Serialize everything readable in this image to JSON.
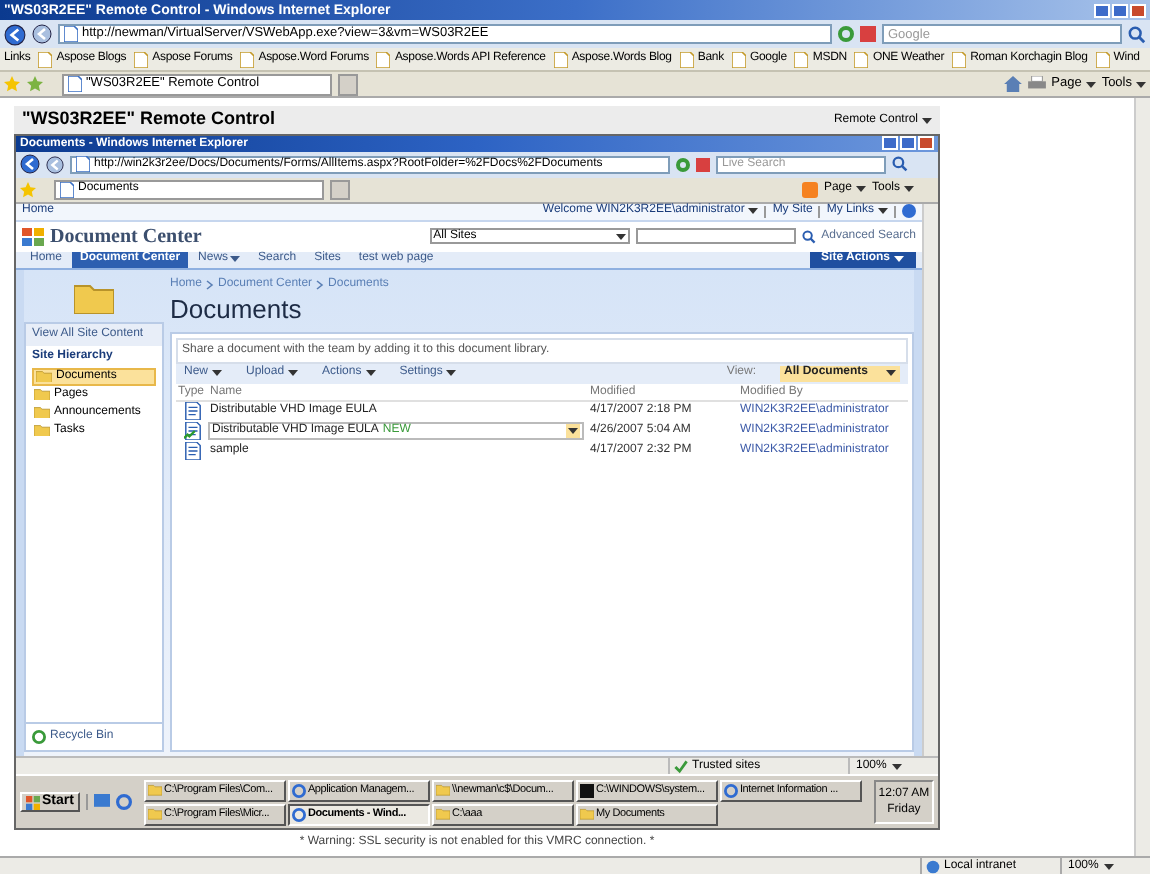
{
  "window": {
    "title": "\"WS03R2EE\" Remote Control - Windows Internet Explorer",
    "address": "http://newman/VirtualServer/VSWebApp.exe?view=3&vm=WS03R2EE",
    "search_placeholder": "Google",
    "links_label": "Links",
    "links": [
      "Aspose Blogs",
      "Aspose Forums",
      "Aspose.Word Forums",
      "Aspose.Words API Reference",
      "Aspose.Words Blog",
      "Bank",
      "Google",
      "MSDN",
      "ONE Weather",
      "Roman Korchagin Blog",
      "Wind"
    ],
    "tabs": [
      {
        "label": "\"WS03R2EE\" Remote Control",
        "selected": true
      }
    ],
    "page_menu": "Page",
    "tools_menu": "Tools"
  },
  "page": {
    "heading": "\"WS03R2EE\" Remote Control",
    "menu": "Remote Control"
  },
  "vm": {
    "title": "Documents - Windows Internet Explorer",
    "address": "http://win2k3r2ee/Docs/Documents/Forms/AllItems.aspx?RootFolder=%2FDocs%2FDocuments",
    "search_placeholder": "Live Search",
    "tabs": [
      {
        "label": "Documents",
        "selected": true
      }
    ],
    "page_menu": "Page",
    "tools_menu": "Tools",
    "sharepoint": {
      "top_link": "Home",
      "welcome": "Welcome WIN2K3R2EE\\administrator",
      "my_site": "My Site",
      "my_links": "My Links",
      "site_title": "Document Center",
      "scope": "All Sites",
      "advanced_search": "Advanced Search",
      "nav": [
        {
          "label": "Home",
          "selected": false,
          "menu": false
        },
        {
          "label": "Document Center",
          "selected": true,
          "menu": false
        },
        {
          "label": "News",
          "selected": false,
          "menu": true
        },
        {
          "label": "Search",
          "selected": false,
          "menu": false
        },
        {
          "label": "Sites",
          "selected": false,
          "menu": false
        },
        {
          "label": "test web page",
          "selected": false,
          "menu": false
        }
      ],
      "site_actions": "Site Actions",
      "view_all": "View All Site Content",
      "hierarchy_title": "Site Hierarchy",
      "hierarchy": [
        {
          "label": "Documents",
          "selected": true
        },
        {
          "label": "Pages",
          "selected": false
        },
        {
          "label": "Announcements",
          "selected": false
        },
        {
          "label": "Tasks",
          "selected": false
        }
      ],
      "recycle_bin": "Recycle Bin",
      "breadcrumb": [
        "Home",
        "Document Center",
        "Documents"
      ],
      "page_title": "Documents",
      "description": "Share a document with the team by adding it to this document library.",
      "toolbar": [
        "New",
        "Upload",
        "Actions",
        "Settings"
      ],
      "view_label": "View:",
      "view": "All Documents",
      "columns": [
        "Type",
        "Name",
        "Modified",
        "Modified By"
      ],
      "rows": [
        {
          "name": "Distributable VHD Image EULA",
          "badge": null,
          "modified": "4/17/2007 2:18 PM",
          "by": "WIN2K3R2EE\\administrator",
          "selected": false,
          "checked_out": false
        },
        {
          "name": "Distributable VHD Image EULA",
          "badge": "NEW",
          "modified": "4/26/2007 5:04 AM",
          "by": "WIN2K3R2EE\\administrator",
          "selected": true,
          "checked_out": true
        },
        {
          "name": "sample",
          "badge": null,
          "modified": "4/17/2007 2:32 PM",
          "by": "WIN2K3R2EE\\administrator",
          "selected": false,
          "checked_out": false
        }
      ]
    },
    "status_zone": "Trusted sites",
    "zoom": "100%",
    "start": "Start",
    "taskbar": [
      {
        "label": "C:\\Program Files\\Com...",
        "kind": "folder",
        "selected": false
      },
      {
        "label": "Application Managem...",
        "kind": "browser",
        "selected": false
      },
      {
        "label": "\\\\newman\\c$\\Docum...",
        "kind": "folder",
        "selected": false
      },
      {
        "label": "C:\\WINDOWS\\system...",
        "kind": "console",
        "selected": false
      },
      {
        "label": "Internet Information ...",
        "kind": "browser",
        "selected": false
      },
      {
        "label": "C:\\Program Files\\Micr...",
        "kind": "folder",
        "selected": false
      },
      {
        "label": "Documents - Wind...",
        "kind": "browser",
        "selected": true
      },
      {
        "label": "C:\\aaa",
        "kind": "folder",
        "selected": false
      },
      {
        "label": "My Documents",
        "kind": "folder",
        "selected": false
      }
    ],
    "clock": "12:07 AM",
    "day": "Friday"
  },
  "warning": "* Warning: SSL security is not enabled for this VMRC connection. *",
  "status_bar": {
    "zone": "Local intranet",
    "zoom": "100%"
  }
}
